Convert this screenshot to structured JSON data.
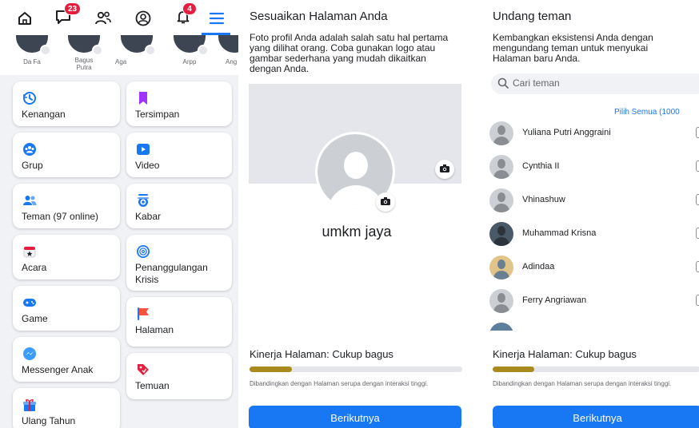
{
  "left_panel": {
    "nav": {
      "home_icon": "home-icon",
      "messages_badge": "23",
      "friends_icon": "friends-icon",
      "profile_icon": "profile-icon",
      "notifications_badge": "4",
      "menu_icon": "menu-icon"
    },
    "friends_strip": [
      {
        "name": "Da Fa"
      },
      {
        "name": "Bagus Putra"
      },
      {
        "name": "Aga"
      },
      {
        "name": "Arpp"
      },
      {
        "name": "Ang"
      }
    ],
    "shortcuts": [
      {
        "label": "Kenangan",
        "icon": "memories-icon",
        "color": "#1877f2"
      },
      {
        "label": "Tersimpan",
        "icon": "saved-icon",
        "color": "#a033ff"
      },
      {
        "label": "Grup",
        "icon": "groups-icon",
        "color": "#1877f2"
      },
      {
        "label": "Video",
        "icon": "video-icon",
        "color": "#1877f2"
      },
      {
        "label": "Teman (97 online)",
        "icon": "friends-icon",
        "color": "#1877f2"
      },
      {
        "label": "Kabar",
        "icon": "feeds-icon",
        "color": "#1877f2"
      },
      {
        "label": "Acara",
        "icon": "events-icon",
        "color": "#e41e3f"
      },
      {
        "label": "Penanggulangan Krisis",
        "icon": "crisis-response-icon",
        "color": "#1877f2"
      },
      {
        "label": "Game",
        "icon": "gaming-icon",
        "color": "#1877f2"
      },
      {
        "label": "Halaman",
        "icon": "pages-flag-icon",
        "color": "#f7533e"
      },
      {
        "label": "Messenger Anak",
        "icon": "messenger-kids-icon",
        "color": "#1877f2"
      },
      {
        "label": "Temuan",
        "icon": "offers-tag-icon",
        "color": "#e41e3f"
      },
      {
        "label": "Ulang Tahun",
        "icon": "birthday-gift-icon",
        "color": "#1877f2"
      }
    ]
  },
  "middle_panel": {
    "title": "Sesuaikan Halaman Anda",
    "description": "Foto profil Anda adalah salah satu hal pertama yang dilihat orang. Coba gunakan logo atau gambar sederhana yang mudah dikaitkan dengan Anda.",
    "page_name": "umkm jaya",
    "performance_label": "Kinerja Halaman: Cukup bagus",
    "performance_level": 0.2,
    "comparison_note": "Dibandingkan dengan Halaman serupa dengan interaksi tinggi.",
    "next_button": "Berikutnya"
  },
  "right_panel": {
    "title": "Undang teman",
    "description": "Kembangkan eksistensi Anda dengan mengundang teman untuk menyukai Halaman baru Anda.",
    "search_placeholder": "Cari teman",
    "select_all": "Pilih Semua (1000",
    "friends": [
      {
        "name": "Yuliana Putri Anggraini",
        "photo": false
      },
      {
        "name": "Cynthia II",
        "photo": false
      },
      {
        "name": "Vhinashuw",
        "photo": false
      },
      {
        "name": "Muhammad Krisna",
        "photo": true
      },
      {
        "name": "Adindaa",
        "photo": true
      },
      {
        "name": "Ferry Angriawan",
        "photo": false
      }
    ],
    "performance_label": "Kinerja Halaman: Cukup bagus",
    "performance_level": 0.2,
    "comparison_note": "Dibandingkan dengan Halaman serupa dengan interaksi tinggi.",
    "next_button": "Berikutnya"
  },
  "colors": {
    "accent": "#1877f2",
    "badge": "#e41e3f",
    "performance": "#a98b1d"
  }
}
